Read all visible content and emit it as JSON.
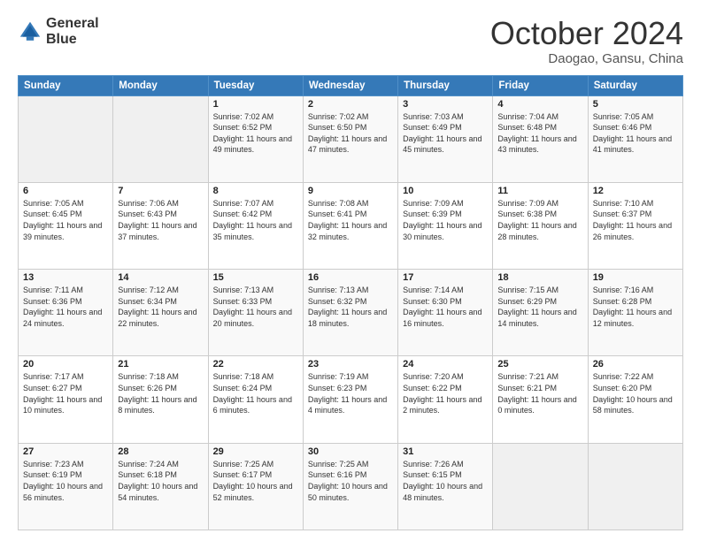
{
  "header": {
    "logo_line1": "General",
    "logo_line2": "Blue",
    "month": "October 2024",
    "location": "Daogao, Gansu, China"
  },
  "weekdays": [
    "Sunday",
    "Monday",
    "Tuesday",
    "Wednesday",
    "Thursday",
    "Friday",
    "Saturday"
  ],
  "weeks": [
    [
      {
        "day": "",
        "sunrise": "",
        "sunset": "",
        "daylight": ""
      },
      {
        "day": "",
        "sunrise": "",
        "sunset": "",
        "daylight": ""
      },
      {
        "day": "1",
        "sunrise": "Sunrise: 7:02 AM",
        "sunset": "Sunset: 6:52 PM",
        "daylight": "Daylight: 11 hours and 49 minutes."
      },
      {
        "day": "2",
        "sunrise": "Sunrise: 7:02 AM",
        "sunset": "Sunset: 6:50 PM",
        "daylight": "Daylight: 11 hours and 47 minutes."
      },
      {
        "day": "3",
        "sunrise": "Sunrise: 7:03 AM",
        "sunset": "Sunset: 6:49 PM",
        "daylight": "Daylight: 11 hours and 45 minutes."
      },
      {
        "day": "4",
        "sunrise": "Sunrise: 7:04 AM",
        "sunset": "Sunset: 6:48 PM",
        "daylight": "Daylight: 11 hours and 43 minutes."
      },
      {
        "day": "5",
        "sunrise": "Sunrise: 7:05 AM",
        "sunset": "Sunset: 6:46 PM",
        "daylight": "Daylight: 11 hours and 41 minutes."
      }
    ],
    [
      {
        "day": "6",
        "sunrise": "Sunrise: 7:05 AM",
        "sunset": "Sunset: 6:45 PM",
        "daylight": "Daylight: 11 hours and 39 minutes."
      },
      {
        "day": "7",
        "sunrise": "Sunrise: 7:06 AM",
        "sunset": "Sunset: 6:43 PM",
        "daylight": "Daylight: 11 hours and 37 minutes."
      },
      {
        "day": "8",
        "sunrise": "Sunrise: 7:07 AM",
        "sunset": "Sunset: 6:42 PM",
        "daylight": "Daylight: 11 hours and 35 minutes."
      },
      {
        "day": "9",
        "sunrise": "Sunrise: 7:08 AM",
        "sunset": "Sunset: 6:41 PM",
        "daylight": "Daylight: 11 hours and 32 minutes."
      },
      {
        "day": "10",
        "sunrise": "Sunrise: 7:09 AM",
        "sunset": "Sunset: 6:39 PM",
        "daylight": "Daylight: 11 hours and 30 minutes."
      },
      {
        "day": "11",
        "sunrise": "Sunrise: 7:09 AM",
        "sunset": "Sunset: 6:38 PM",
        "daylight": "Daylight: 11 hours and 28 minutes."
      },
      {
        "day": "12",
        "sunrise": "Sunrise: 7:10 AM",
        "sunset": "Sunset: 6:37 PM",
        "daylight": "Daylight: 11 hours and 26 minutes."
      }
    ],
    [
      {
        "day": "13",
        "sunrise": "Sunrise: 7:11 AM",
        "sunset": "Sunset: 6:36 PM",
        "daylight": "Daylight: 11 hours and 24 minutes."
      },
      {
        "day": "14",
        "sunrise": "Sunrise: 7:12 AM",
        "sunset": "Sunset: 6:34 PM",
        "daylight": "Daylight: 11 hours and 22 minutes."
      },
      {
        "day": "15",
        "sunrise": "Sunrise: 7:13 AM",
        "sunset": "Sunset: 6:33 PM",
        "daylight": "Daylight: 11 hours and 20 minutes."
      },
      {
        "day": "16",
        "sunrise": "Sunrise: 7:13 AM",
        "sunset": "Sunset: 6:32 PM",
        "daylight": "Daylight: 11 hours and 18 minutes."
      },
      {
        "day": "17",
        "sunrise": "Sunrise: 7:14 AM",
        "sunset": "Sunset: 6:30 PM",
        "daylight": "Daylight: 11 hours and 16 minutes."
      },
      {
        "day": "18",
        "sunrise": "Sunrise: 7:15 AM",
        "sunset": "Sunset: 6:29 PM",
        "daylight": "Daylight: 11 hours and 14 minutes."
      },
      {
        "day": "19",
        "sunrise": "Sunrise: 7:16 AM",
        "sunset": "Sunset: 6:28 PM",
        "daylight": "Daylight: 11 hours and 12 minutes."
      }
    ],
    [
      {
        "day": "20",
        "sunrise": "Sunrise: 7:17 AM",
        "sunset": "Sunset: 6:27 PM",
        "daylight": "Daylight: 11 hours and 10 minutes."
      },
      {
        "day": "21",
        "sunrise": "Sunrise: 7:18 AM",
        "sunset": "Sunset: 6:26 PM",
        "daylight": "Daylight: 11 hours and 8 minutes."
      },
      {
        "day": "22",
        "sunrise": "Sunrise: 7:18 AM",
        "sunset": "Sunset: 6:24 PM",
        "daylight": "Daylight: 11 hours and 6 minutes."
      },
      {
        "day": "23",
        "sunrise": "Sunrise: 7:19 AM",
        "sunset": "Sunset: 6:23 PM",
        "daylight": "Daylight: 11 hours and 4 minutes."
      },
      {
        "day": "24",
        "sunrise": "Sunrise: 7:20 AM",
        "sunset": "Sunset: 6:22 PM",
        "daylight": "Daylight: 11 hours and 2 minutes."
      },
      {
        "day": "25",
        "sunrise": "Sunrise: 7:21 AM",
        "sunset": "Sunset: 6:21 PM",
        "daylight": "Daylight: 11 hours and 0 minutes."
      },
      {
        "day": "26",
        "sunrise": "Sunrise: 7:22 AM",
        "sunset": "Sunset: 6:20 PM",
        "daylight": "Daylight: 10 hours and 58 minutes."
      }
    ],
    [
      {
        "day": "27",
        "sunrise": "Sunrise: 7:23 AM",
        "sunset": "Sunset: 6:19 PM",
        "daylight": "Daylight: 10 hours and 56 minutes."
      },
      {
        "day": "28",
        "sunrise": "Sunrise: 7:24 AM",
        "sunset": "Sunset: 6:18 PM",
        "daylight": "Daylight: 10 hours and 54 minutes."
      },
      {
        "day": "29",
        "sunrise": "Sunrise: 7:25 AM",
        "sunset": "Sunset: 6:17 PM",
        "daylight": "Daylight: 10 hours and 52 minutes."
      },
      {
        "day": "30",
        "sunrise": "Sunrise: 7:25 AM",
        "sunset": "Sunset: 6:16 PM",
        "daylight": "Daylight: 10 hours and 50 minutes."
      },
      {
        "day": "31",
        "sunrise": "Sunrise: 7:26 AM",
        "sunset": "Sunset: 6:15 PM",
        "daylight": "Daylight: 10 hours and 48 minutes."
      },
      {
        "day": "",
        "sunrise": "",
        "sunset": "",
        "daylight": ""
      },
      {
        "day": "",
        "sunrise": "",
        "sunset": "",
        "daylight": ""
      }
    ]
  ]
}
